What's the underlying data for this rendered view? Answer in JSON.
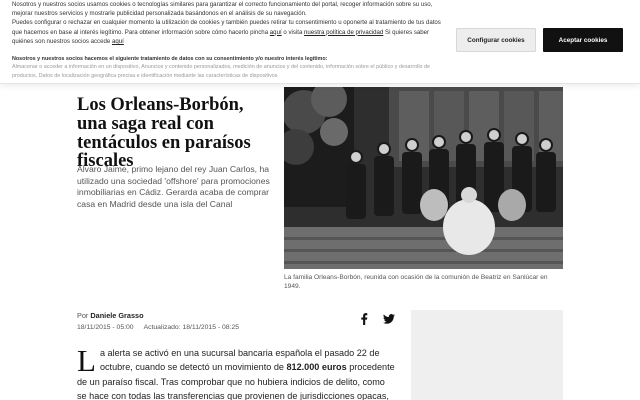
{
  "cookie_banner": {
    "text_1": "Nosotros y nuestros socios usamos cookies o tecnologías similares para garantizar el correcto funcionamiento del portal, recoger información sobre su uso, mejorar nuestros servicios y mostrarle publicidad personalizada basándonos en el análisis de su navegación.",
    "text_2_pre": "Puedes configurar o rechazar en cualquier momento la utilización de cookies y también puedes retirar tu consentimiento u oponerte al tratamiento de tus datos que hacemos en base al interés legítimo. Para obtener información sobre cómo hacerlo pincha",
    "link_here": "aquí",
    "text_2_mid": "o visita",
    "link_policy": "nuestra política de privacidad",
    "text_2_post": "Si quieres saber quiénes son nuestros socios accede",
    "link_partners": "aquí",
    "purposes_heading": "Nosotros y nuestros socios hacemos el siguiente tratamiento de datos con su consentimiento y/o nuestro interés legítimo:",
    "purposes_list": "Almacenar o acceder a información en un dispositivo, Anuncios y contenido personalizados, medición de anuncios y del contenido, información sobre el público y desarrollo de productos, Datos de localización geográfica precisa e identificación mediante las características de dispositivos",
    "configure_label": "Configurar cookies",
    "accept_label": "Aceptar cookies"
  },
  "article": {
    "headline": "Los Orleans-Borbón, una saga real con tentáculos en paraísos fiscales",
    "standfirst": "Álvaro Jaime, primo lejano del rey Juan Carlos, ha utilizado una sociedad 'offshore' para promociones inmobiliarias en Cádiz. Gerarda acaba de comprar casa en Madrid desde una isla del Canal",
    "photo_caption": "La familia Orleans-Borbón, reunida con ocasión de la comunión de Beatriz en Sanlúcar en 1949.",
    "byline_prefix": "Por",
    "author": "Daniele Grasso",
    "published": "18/11/2015 - 05:00",
    "updated": "Actualizado: 18/11/2015 - 08:25",
    "share_icons": [
      "facebook-icon",
      "twitter-icon"
    ],
    "body": {
      "dropcap": "L",
      "part_1": "a alerta se activó en una sucursal bancaria española el pasado 22 de octubre, cuando se detectó un movimiento de",
      "highlight": "812.000 euros",
      "part_2": "procedente de un paraíso fiscal. Tras comprobar que no hubiera indicios de delito, como se hace con todas las transferencias que provienen de jurisdicciones opacas, el"
    }
  },
  "colors": {
    "accept_button": "#111111",
    "configure_button": "#ededed",
    "ad_placeholder": "#efefef"
  }
}
